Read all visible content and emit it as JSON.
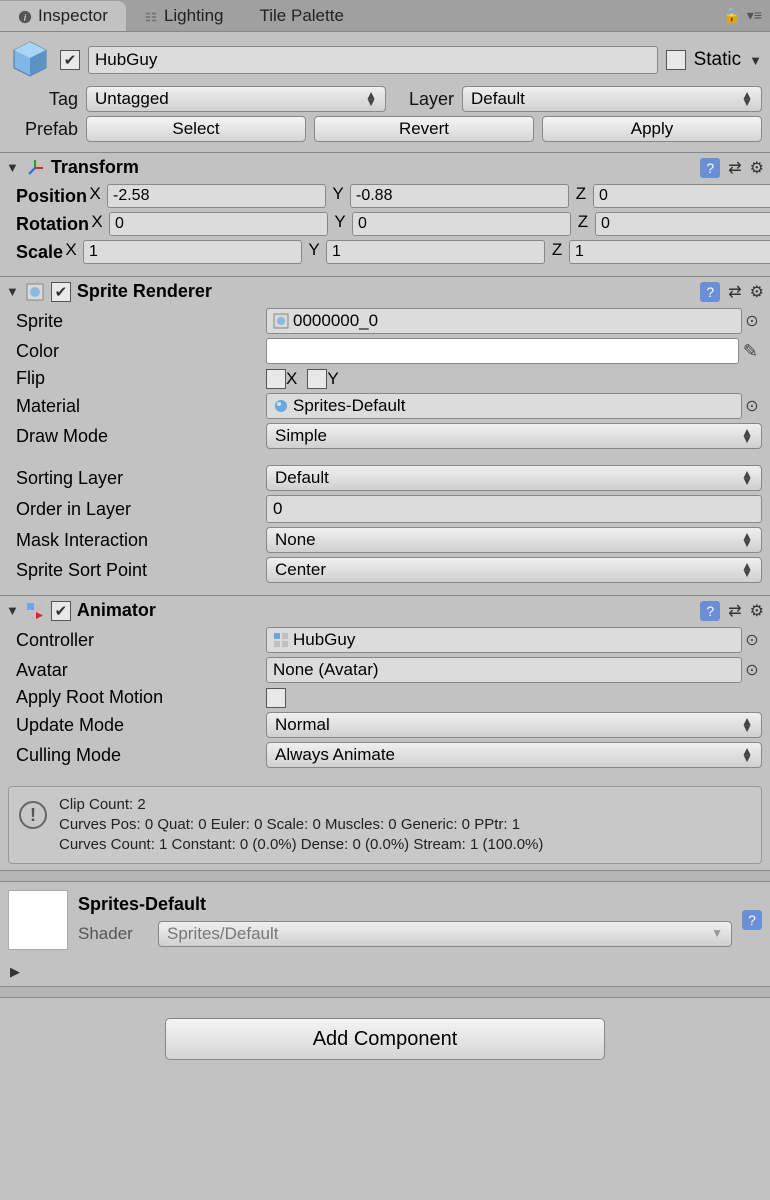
{
  "tabs": {
    "inspector": "Inspector",
    "lighting": "Lighting",
    "tilepalette": "Tile Palette"
  },
  "header": {
    "name": "HubGuy",
    "static_label": "Static",
    "tag_label": "Tag",
    "tag_value": "Untagged",
    "layer_label": "Layer",
    "layer_value": "Default",
    "prefab_label": "Prefab",
    "select_btn": "Select",
    "revert_btn": "Revert",
    "apply_btn": "Apply"
  },
  "transform": {
    "title": "Transform",
    "position_label": "Position",
    "pos": {
      "x": "-2.58",
      "y": "-0.88",
      "z": "0"
    },
    "rotation_label": "Rotation",
    "rot": {
      "x": "0",
      "y": "0",
      "z": "0"
    },
    "scale_label": "Scale",
    "scl": {
      "x": "1",
      "y": "1",
      "z": "1"
    },
    "X": "X",
    "Y": "Y",
    "Z": "Z"
  },
  "sprite_renderer": {
    "title": "Sprite Renderer",
    "sprite_label": "Sprite",
    "sprite_value": "0000000_0",
    "color_label": "Color",
    "flip_label": "Flip",
    "flip_x": "X",
    "flip_y": "Y",
    "material_label": "Material",
    "material_value": "Sprites-Default",
    "drawmode_label": "Draw Mode",
    "drawmode_value": "Simple",
    "sortlayer_label": "Sorting Layer",
    "sortlayer_value": "Default",
    "order_label": "Order in Layer",
    "order_value": "0",
    "mask_label": "Mask Interaction",
    "mask_value": "None",
    "sortpoint_label": "Sprite Sort Point",
    "sortpoint_value": "Center"
  },
  "animator": {
    "title": "Animator",
    "controller_label": "Controller",
    "controller_value": "HubGuy",
    "avatar_label": "Avatar",
    "avatar_value": "None (Avatar)",
    "rootmotion_label": "Apply Root Motion",
    "updatemode_label": "Update Mode",
    "updatemode_value": "Normal",
    "cullingmode_label": "Culling Mode",
    "cullingmode_value": "Always Animate",
    "info_line1": "Clip Count: 2",
    "info_line2": "Curves Pos: 0 Quat: 0 Euler: 0 Scale: 0 Muscles: 0 Generic: 0 PPtr: 1",
    "info_line3": "Curves Count: 1 Constant: 0 (0.0%) Dense: 0 (0.0%) Stream: 1 (100.0%)"
  },
  "material": {
    "name": "Sprites-Default",
    "shader_label": "Shader",
    "shader_value": "Sprites/Default"
  },
  "add_component": "Add Component"
}
